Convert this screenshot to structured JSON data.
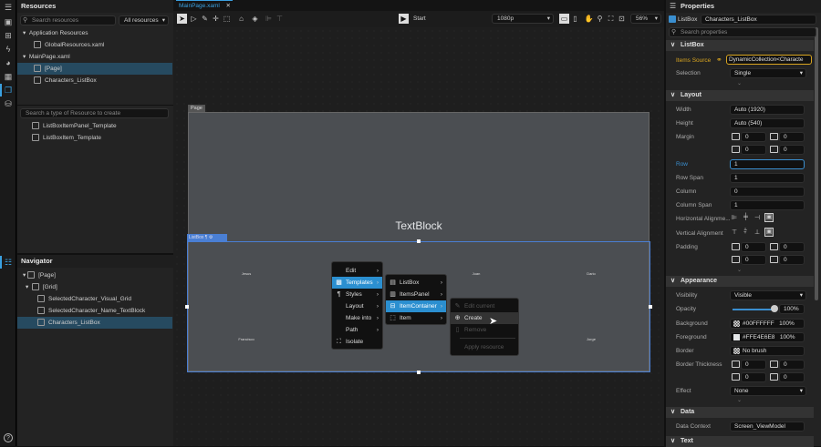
{
  "resources": {
    "title": "Resources",
    "search_placeholder": "Search resources",
    "filter": "All resources",
    "tree": [
      {
        "label": "Application Resources"
      },
      {
        "label": "GlobalResources.xaml"
      },
      {
        "label": "MainPage.xaml"
      },
      {
        "label": "[Page]",
        "selected": true
      },
      {
        "label": "Characters_ListBox"
      }
    ],
    "create_placeholder": "Search a type of Resource to create",
    "templates": [
      "ListBoxItemPanel_Template",
      "ListBoxItem_Template"
    ]
  },
  "navigator": {
    "title": "Navigator",
    "tree": [
      {
        "label": "[Page]"
      },
      {
        "label": "[Grid]"
      },
      {
        "label": "SelectedCharacter_Visual_Grid"
      },
      {
        "label": "SelectedCharacter_Name_TextBlock"
      },
      {
        "label": "Characters_ListBox",
        "selected": true
      }
    ]
  },
  "document": {
    "tab": "MainPage.xaml",
    "start": "Start",
    "resolution": "1080p",
    "zoom": "56%"
  },
  "canvas": {
    "page_label": "Page",
    "textblock": "TextBlock",
    "listbox_label": "ListBox",
    "items": [
      "Jesus",
      "Juan",
      "Dario",
      "Francisco",
      "Jorge"
    ]
  },
  "context_menu": {
    "main": [
      {
        "label": "Edit"
      },
      {
        "label": "Templates",
        "active": true
      },
      {
        "label": "Styles"
      },
      {
        "label": "Layout"
      },
      {
        "label": "Make into"
      },
      {
        "label": "Path"
      },
      {
        "label": "Isolate"
      }
    ],
    "templates": [
      {
        "label": "ListBox"
      },
      {
        "label": "ItemsPanel"
      },
      {
        "label": "ItemContainer",
        "active": true
      },
      {
        "label": "Item"
      }
    ],
    "item_container": [
      {
        "label": "Edit current",
        "disabled": true
      },
      {
        "label": "Create",
        "hover": true
      },
      {
        "label": "Remove",
        "disabled": true
      },
      {
        "label": "Apply resource",
        "disabled": true
      }
    ]
  },
  "properties": {
    "title": "Properties",
    "type": "ListBox",
    "name": "Characters_ListBox",
    "search_placeholder": "Search properties",
    "listbox": {
      "title": "ListBox",
      "items_source_label": "Items Source",
      "items_source": "DynamicCollection<Characte",
      "selection_label": "Selection",
      "selection": "Single"
    },
    "layout": {
      "title": "Layout",
      "width_label": "Width",
      "width": "Auto (1920)",
      "height_label": "Height",
      "height": "Auto (540)",
      "margin_label": "Margin",
      "margin": [
        "0",
        "0",
        "0",
        "0"
      ],
      "row_label": "Row",
      "row": "1",
      "rowspan_label": "Row Span",
      "rowspan": "1",
      "column_label": "Column",
      "column": "0",
      "colspan_label": "Column Span",
      "colspan": "1",
      "halign_label": "Horizontal Alignme...",
      "valign_label": "Vertical Alignment",
      "padding_label": "Padding",
      "padding": [
        "0",
        "0",
        "0",
        "0"
      ]
    },
    "appearance": {
      "title": "Appearance",
      "visibility_label": "Visibility",
      "visibility": "Visible",
      "opacity_label": "Opacity",
      "opacity": "100%",
      "opacity_value": 1.0,
      "background_label": "Background",
      "background": "#00FFFFFF",
      "background_pct": "100%",
      "foreground_label": "Foreground",
      "foreground": "#FFE4E6E8",
      "foreground_pct": "100%",
      "border_label": "Border",
      "border": "No brush",
      "thickness_label": "Border Thickness",
      "thickness": [
        "0",
        "0",
        "0",
        "0"
      ],
      "effect_label": "Effect",
      "effect": "None"
    },
    "data": {
      "title": "Data",
      "context_label": "Data Context",
      "context": "Screen_ViewModel"
    },
    "text": {
      "title": "Text"
    }
  },
  "colors": {
    "accent": "#2b8fd0",
    "selection": "#264a60",
    "items_source": "#d9a520"
  }
}
